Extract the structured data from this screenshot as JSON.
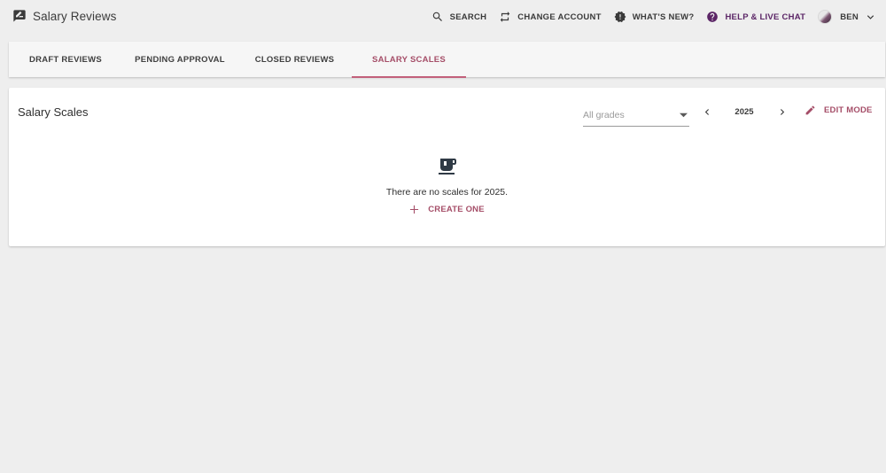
{
  "app": {
    "title": "Salary Reviews",
    "logo_icon": "rate-review-icon"
  },
  "header": {
    "search_label": "SEARCH",
    "change_account_label": "CHANGE ACCOUNT",
    "whats_new_label": "WHAT'S NEW?",
    "help_label": "HELP & LIVE CHAT",
    "user_name": "BEN"
  },
  "tabs": [
    {
      "label": "DRAFT REVIEWS",
      "active": false
    },
    {
      "label": "PENDING APPROVAL",
      "active": false
    },
    {
      "label": "CLOSED REVIEWS",
      "active": false
    },
    {
      "label": "SALARY SCALES",
      "active": true
    }
  ],
  "main": {
    "title": "Salary Scales",
    "grade_select": {
      "placeholder": "All grades"
    },
    "year": "2025",
    "edit_mode_label": "EDIT MODE",
    "empty_message": "There are no scales for 2025.",
    "create_label": "CREATE ONE"
  },
  "colors": {
    "accent": "#a54e68",
    "help": "#5b2566",
    "background": "#eeeeee",
    "card": "#ffffff"
  }
}
